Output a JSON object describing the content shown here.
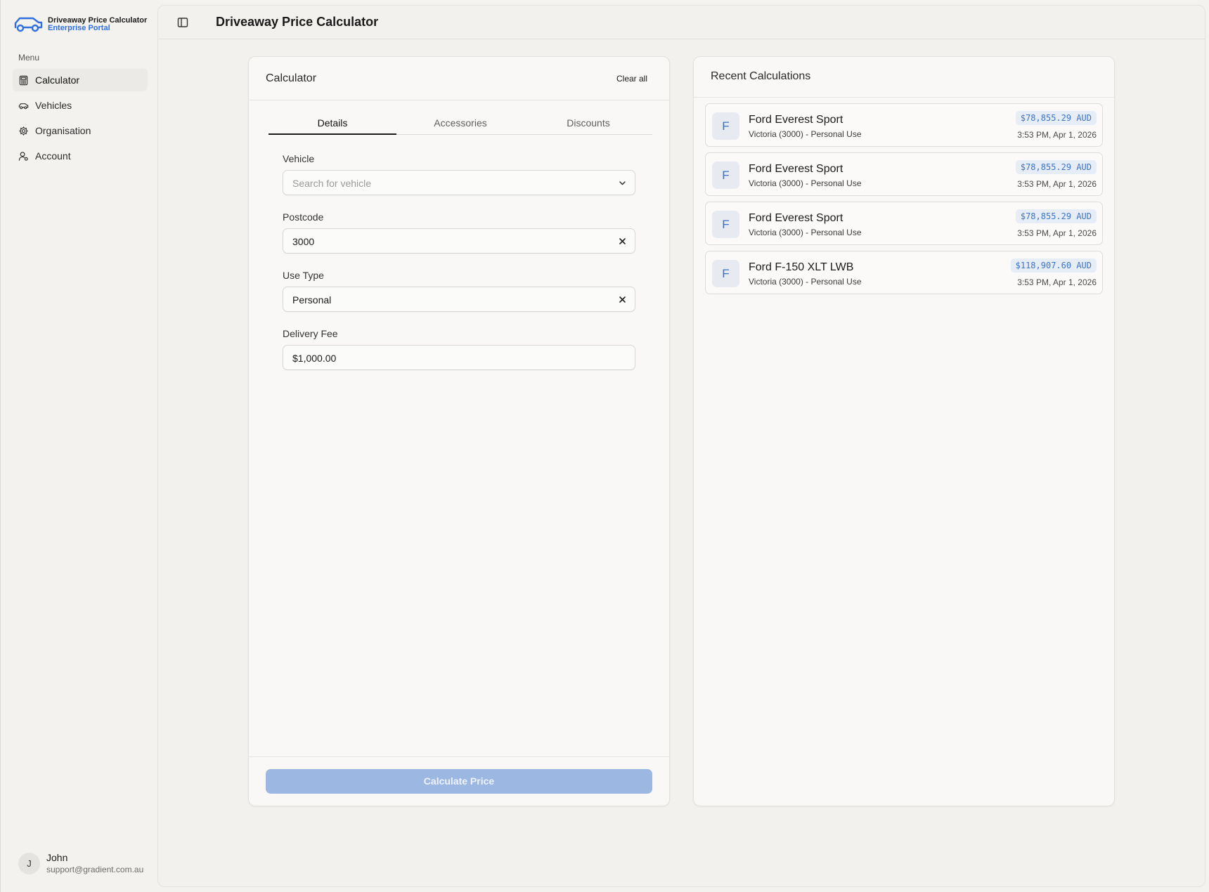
{
  "brand": {
    "title": "Driveaway Price Calculator",
    "subtitle": "Enterprise Portal",
    "logo_icon": "car-icon",
    "accent_color": "#2f6fde"
  },
  "sidebar": {
    "menu_label": "Menu",
    "items": [
      {
        "label": "Calculator",
        "icon": "calculator-icon",
        "active": true
      },
      {
        "label": "Vehicles",
        "icon": "car-icon",
        "active": false
      },
      {
        "label": "Organisation",
        "icon": "gear-icon",
        "active": false
      },
      {
        "label": "Account",
        "icon": "user-icon",
        "active": false
      }
    ],
    "user": {
      "initial": "J",
      "name": "John",
      "email": "support@gradient.com.au"
    }
  },
  "header": {
    "title": "Driveaway Price Calculator",
    "toggle_icon": "sidebar-toggle-icon"
  },
  "calculator": {
    "title": "Calculator",
    "clear_all": "Clear all",
    "tabs": [
      {
        "label": "Details",
        "active": true
      },
      {
        "label": "Accessories",
        "active": false
      },
      {
        "label": "Discounts",
        "active": false
      }
    ],
    "fields": {
      "vehicle": {
        "label": "Vehicle",
        "placeholder": "Search for vehicle",
        "value": ""
      },
      "postcode": {
        "label": "Postcode",
        "value": "3000"
      },
      "use_type": {
        "label": "Use Type",
        "value": "Personal"
      },
      "delivery_fee": {
        "label": "Delivery Fee",
        "value": "$1,000.00"
      }
    },
    "submit_label": "Calculate Price",
    "submit_color": "#9bb7e2"
  },
  "recent": {
    "title": "Recent Calculations",
    "items": [
      {
        "initial": "F",
        "name": "Ford Everest Sport",
        "subtitle": "Victoria (3000) - Personal Use",
        "price": "$78,855.29 AUD",
        "time": "3:53 PM, Apr 1, 2026"
      },
      {
        "initial": "F",
        "name": "Ford Everest Sport",
        "subtitle": "Victoria (3000) - Personal Use",
        "price": "$78,855.29 AUD",
        "time": "3:53 PM, Apr 1, 2026"
      },
      {
        "initial": "F",
        "name": "Ford Everest Sport",
        "subtitle": "Victoria (3000) - Personal Use",
        "price": "$78,855.29 AUD",
        "time": "3:53 PM, Apr 1, 2026"
      },
      {
        "initial": "F",
        "name": "Ford F-150 XLT LWB",
        "subtitle": "Victoria (3000) - Personal Use",
        "price": "$118,907.60 AUD",
        "time": "3:53 PM, Apr 1, 2026"
      }
    ]
  }
}
